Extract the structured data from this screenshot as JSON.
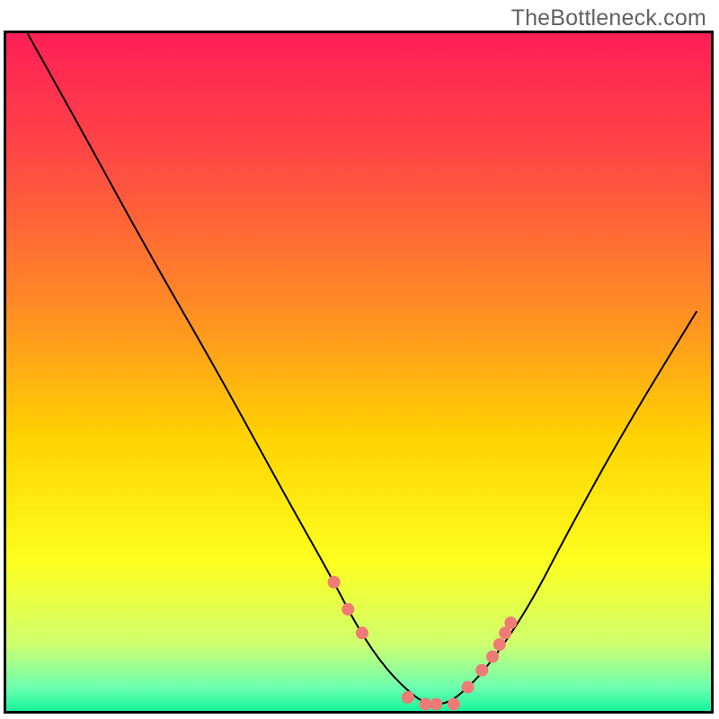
{
  "watermark": "TheBottleneck.com",
  "chart_data": {
    "type": "line",
    "title": "",
    "xlabel": "",
    "ylabel": "",
    "xlim": [
      0,
      100
    ],
    "ylim": [
      0,
      100
    ],
    "grid": false,
    "series": [
      {
        "name": "curve",
        "x": [
          3,
          10,
          20,
          30,
          40,
          46,
          50,
          54,
          58,
          60,
          62,
          64,
          68,
          74,
          80,
          88,
          98
        ],
        "y": [
          100,
          87,
          68,
          50,
          31,
          20,
          12,
          6,
          2,
          1,
          1,
          2,
          6,
          15,
          27,
          42,
          59
        ],
        "color": "#000000",
        "stroke_width": 2,
        "markers": false
      },
      {
        "name": "highlight-points",
        "x": [
          46.5,
          48.5,
          50.5,
          57,
          59.5,
          61,
          63.5,
          65.5,
          67.5,
          69,
          70,
          70.8,
          71.6
        ],
        "y": [
          19,
          15,
          11.5,
          2,
          1,
          1,
          1,
          3.5,
          6,
          8,
          9.8,
          11.5,
          13
        ],
        "color": "#ef7b77",
        "marker_radius": 7,
        "markers": true
      }
    ],
    "background_gradient": {
      "stops": [
        {
          "offset": 0.0,
          "color": "#ff1f56"
        },
        {
          "offset": 0.18,
          "color": "#ff4745"
        },
        {
          "offset": 0.4,
          "color": "#ff8a25"
        },
        {
          "offset": 0.6,
          "color": "#ffd400"
        },
        {
          "offset": 0.78,
          "color": "#fdff1e"
        },
        {
          "offset": 0.9,
          "color": "#d0ff6e"
        },
        {
          "offset": 0.965,
          "color": "#6dffb0"
        },
        {
          "offset": 1.0,
          "color": "#16f59d"
        }
      ]
    }
  }
}
